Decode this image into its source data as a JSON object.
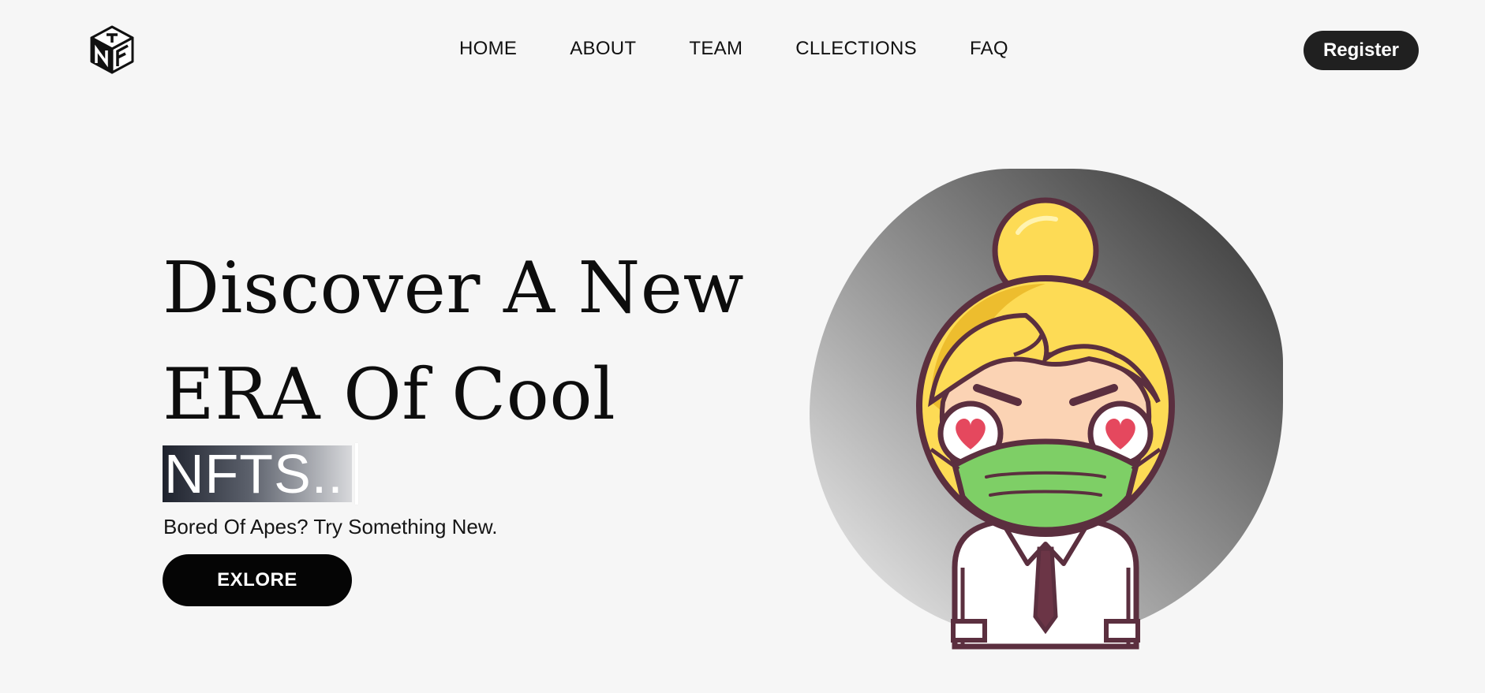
{
  "nav": {
    "items": [
      "HOME",
      "ABOUT",
      "TEAM",
      "CLLECTIONS",
      "FAQ"
    ],
    "register_label": "Register"
  },
  "hero": {
    "title_line1": "Discover A New",
    "title_line2": "ERA Of Cool",
    "highlight": "NFTS..",
    "subtitle": "Bored Of Apes? Try Something New.",
    "cta_label": "EXLORE"
  },
  "icons": {
    "logo": "cube-logo-icon",
    "illustration": "masked-character-illustration"
  },
  "colors": {
    "background": "#f6f6f6",
    "button_dark": "#050505",
    "hair_yellow": "#fddb55",
    "mask_green": "#7ecf66",
    "outline": "#5b2f3f",
    "heart_red": "#e5485e"
  }
}
